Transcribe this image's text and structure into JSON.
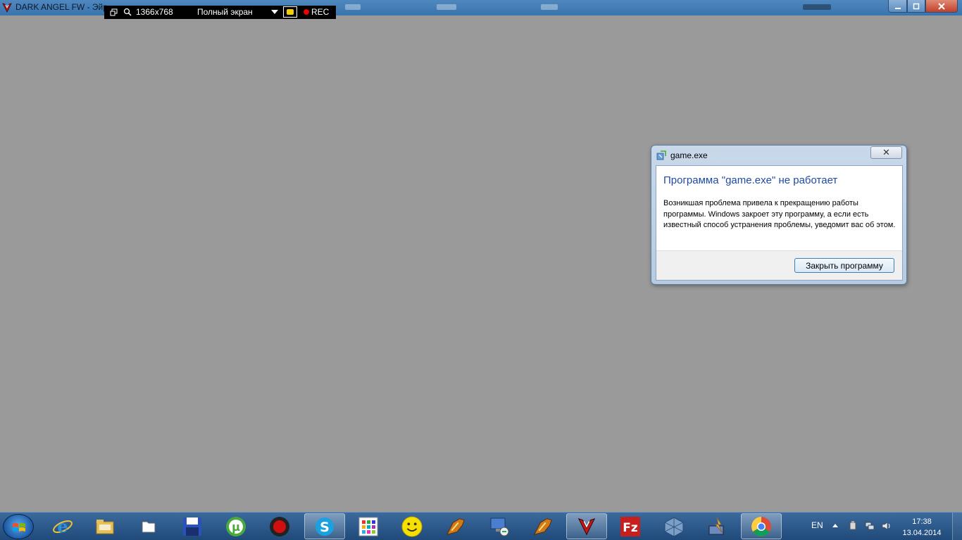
{
  "window": {
    "title": "DARK ANGEL FW - Эйр",
    "minimize_icon": "minimize-icon",
    "maximize_icon": "maximize-icon",
    "close_icon": "close-icon"
  },
  "recorder": {
    "resolution": "1366x768",
    "mode": "Полный экран",
    "rec_label": "REC"
  },
  "dialog": {
    "title": "game.exe",
    "heading": "Программа \"game.exe\" не работает",
    "message": "Возникшая проблема привела к прекращению работы программы. Windows закроет эту программу, а если есть известный способ устранения проблемы, уведомит вас об этом.",
    "close_program_button": "Закрыть программу",
    "close_glyph": "✕"
  },
  "taskbar": {
    "items": [
      {
        "name": "internet-explorer-icon",
        "glyph": "e",
        "color": "#2a8fe0"
      },
      {
        "name": "file-explorer-icon",
        "glyph": "",
        "color": "#e5c15a"
      },
      {
        "name": "folder-window-icon",
        "glyph": "",
        "color": "#ffffff"
      },
      {
        "name": "floppy-save-icon",
        "glyph": "",
        "color": "#2a52b8"
      },
      {
        "name": "utorrent-icon",
        "glyph": "µ",
        "color": "#4aa83c"
      },
      {
        "name": "record-icon",
        "glyph": "",
        "color": "#d01010"
      },
      {
        "name": "skype-icon",
        "glyph": "S",
        "color": "#1ba0e0"
      },
      {
        "name": "apps-grid-icon",
        "glyph": "",
        "color": "#ffffff"
      },
      {
        "name": "smiley-icon",
        "glyph": "",
        "color": "#f5e000"
      },
      {
        "name": "game-launcher-icon",
        "glyph": "",
        "color": "#d07a1a"
      },
      {
        "name": "remote-desktop-icon",
        "glyph": "",
        "color": "#4a7fd0"
      },
      {
        "name": "game-client-icon",
        "glyph": "",
        "color": "#d07a1a"
      },
      {
        "name": "dark-angel-icon",
        "glyph": "",
        "color": "#c01818"
      },
      {
        "name": "filezilla-icon",
        "glyph": "Fz",
        "color": "#c81e1e"
      },
      {
        "name": "virtualbox-icon",
        "glyph": "",
        "color": "#7a9fc8"
      },
      {
        "name": "network-tool-icon",
        "glyph": "",
        "color": "#e0c040"
      },
      {
        "name": "chrome-icon",
        "glyph": "",
        "color": "#dd4b39"
      }
    ],
    "language": "EN",
    "clock_time": "17:38",
    "clock_date": "13.04.2014"
  }
}
